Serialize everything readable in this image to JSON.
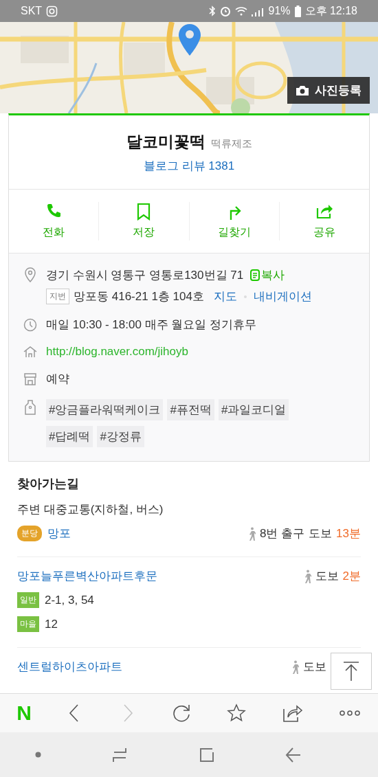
{
  "status_bar": {
    "carrier": "SKT",
    "battery": "91%",
    "time": "오후 12:18"
  },
  "map": {
    "kind": "picture",
    "photo_button": "사진등록"
  },
  "place": {
    "name": "달코미꽃떡",
    "category": "떡류제조",
    "review_link": "블로그 리뷰 1381"
  },
  "actions": [
    {
      "kind": "call",
      "label": "전화"
    },
    {
      "kind": "save",
      "label": "저장"
    },
    {
      "kind": "directions",
      "label": "길찾기"
    },
    {
      "kind": "share",
      "label": "공유"
    }
  ],
  "info": {
    "address": "경기 수원시 영통구 영통로130번길 71",
    "copy": "복사",
    "lot_tag": "지번",
    "lot_address": "망포동 416-21 1층 104호",
    "map_link": "지도",
    "nav_link": "내비게이션",
    "hours": "매일 10:30 - 18:00 매주 월요일 정기휴무",
    "homepage": "http://blog.naver.com/jihoyb",
    "booking": "예약",
    "tags": [
      "#앙금플라워떡케이크",
      "#퓨전떡",
      "#과일코디얼",
      "#답례떡",
      "#강정류"
    ]
  },
  "directions": {
    "title": "찾아가는길",
    "subtitle": "주변 대중교통(지하철, 버스)",
    "subway": {
      "line_badge": "분당",
      "station": "망포",
      "exit": "8번 출구",
      "walk": "도보",
      "minutes": "13분"
    },
    "stops": [
      {
        "name": "망포늘푸른벽산아파트후문",
        "walk": "도보",
        "minutes": "2분",
        "routes": [
          {
            "type": "일반",
            "numbers": "2-1,  3,  54"
          },
          {
            "type": "마을",
            "numbers": "12"
          }
        ]
      },
      {
        "name": "센트럴하이츠아파트",
        "walk": "도보"
      }
    ]
  },
  "browser_toolbar": {
    "logo": "N",
    "items": [
      {
        "kind": "back",
        "disabled": false
      },
      {
        "kind": "forward",
        "disabled": true
      },
      {
        "kind": "reload",
        "disabled": false
      },
      {
        "kind": "bookmark",
        "disabled": false
      },
      {
        "kind": "share",
        "disabled": false
      },
      {
        "kind": "more",
        "disabled": false
      }
    ]
  }
}
